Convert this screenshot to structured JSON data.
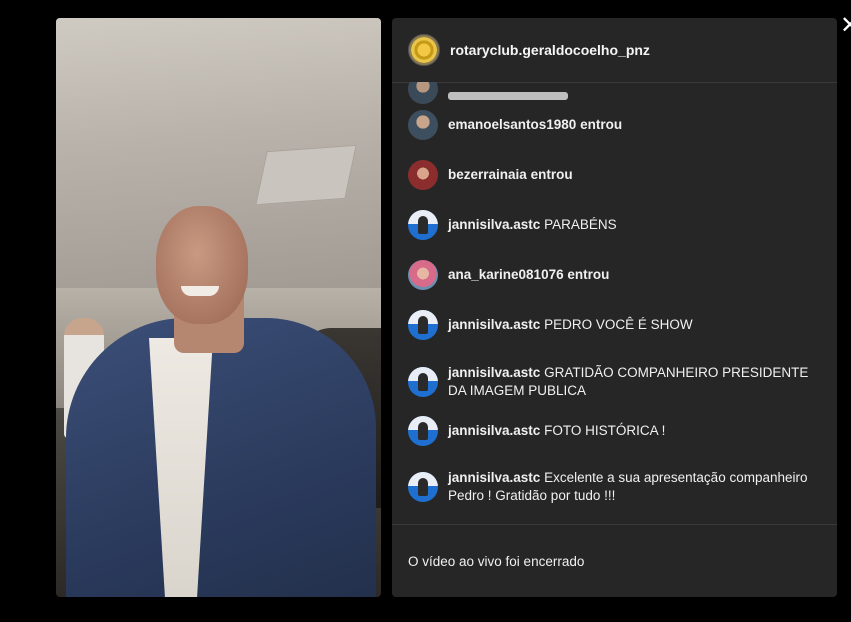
{
  "account": {
    "name": "rotaryclub.geraldocoelho_pnz"
  },
  "comments": [
    {
      "user": "emanoelsantos1980",
      "message": "entrou",
      "avatar": "profile-photo-emanoel"
    },
    {
      "user": "bezerrainaia",
      "message": "entrou",
      "avatar": "profile-photo-bezerra"
    },
    {
      "user": "jannisilva.astc",
      "message": "PARABÉNS",
      "avatar": "profile-photo-janni"
    },
    {
      "user": "ana_karine081076",
      "message": "entrou",
      "avatar": "profile-photo-ana"
    },
    {
      "user": "jannisilva.astc",
      "message": "PEDRO VOCÊ É SHOW",
      "avatar": "profile-photo-janni"
    },
    {
      "user": "jannisilva.astc",
      "message": "GRATIDÃO COMPANHEIRO PRESIDENTE DA IMAGEM PUBLICA",
      "avatar": "profile-photo-janni"
    },
    {
      "user": "jannisilva.astc",
      "message": "FOTO HISTÓRICA !",
      "avatar": "profile-photo-janni"
    },
    {
      "user": "jannisilva.astc",
      "message": "Excelente a sua apresentação companheiro Pedro ! Gratidão por tudo !!!",
      "avatar": "profile-photo-janni"
    }
  ],
  "footer": {
    "status": "O vídeo ao vivo foi encerrado"
  },
  "icons": {
    "close": "close-icon"
  }
}
